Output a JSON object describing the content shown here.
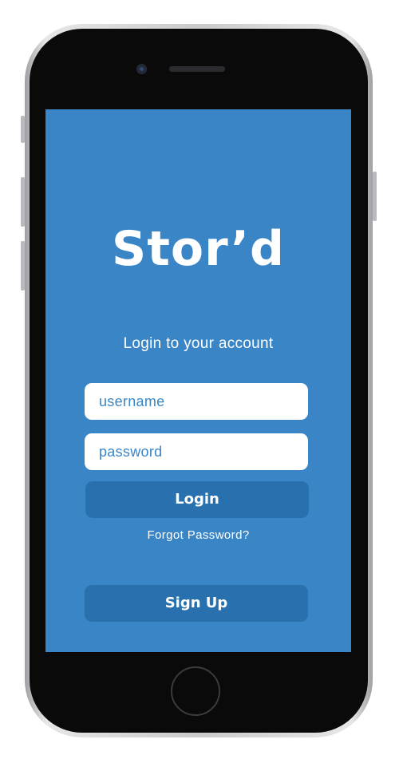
{
  "app": {
    "logo_text": "Stor’d",
    "subtitle": "Login to your account"
  },
  "login_form": {
    "username_placeholder": "username",
    "password_placeholder": "password",
    "login_label": "Login",
    "forgot_label": "Forgot Password?",
    "signup_label": "Sign Up"
  },
  "colors": {
    "screen_background": "#3a85c6",
    "button_background": "#2871ae",
    "field_background": "#ffffff",
    "text_on_blue": "#ffffff",
    "placeholder_text": "#3a85c6"
  },
  "icons": [
    "front-camera-icon",
    "earpiece-speaker-icon",
    "home-button-icon"
  ]
}
